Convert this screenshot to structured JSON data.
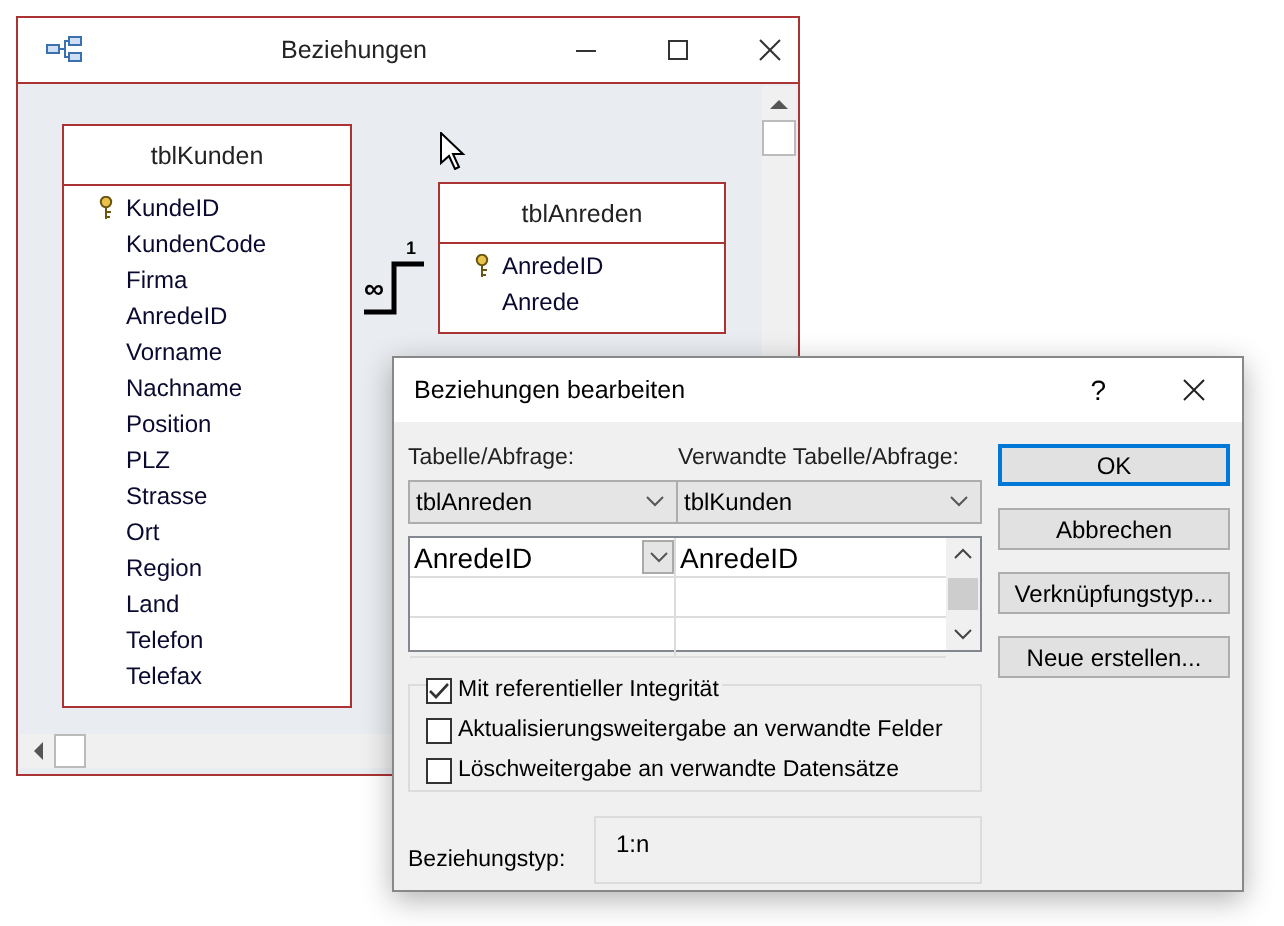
{
  "back_window": {
    "title": "Beziehungen",
    "tables": [
      {
        "name": "tblKunden",
        "fields": [
          {
            "name": "KundeID",
            "primary_key": true
          },
          {
            "name": "KundenCode",
            "primary_key": false
          },
          {
            "name": "Firma",
            "primary_key": false
          },
          {
            "name": "AnredeID",
            "primary_key": false
          },
          {
            "name": "Vorname",
            "primary_key": false
          },
          {
            "name": "Nachname",
            "primary_key": false
          },
          {
            "name": "Position",
            "primary_key": false
          },
          {
            "name": "PLZ",
            "primary_key": false
          },
          {
            "name": "Strasse",
            "primary_key": false
          },
          {
            "name": "Ort",
            "primary_key": false
          },
          {
            "name": "Region",
            "primary_key": false
          },
          {
            "name": "Land",
            "primary_key": false
          },
          {
            "name": "Telefon",
            "primary_key": false
          },
          {
            "name": "Telefax",
            "primary_key": false
          }
        ]
      },
      {
        "name": "tblAnreden",
        "fields": [
          {
            "name": "AnredeID",
            "primary_key": true
          },
          {
            "name": "Anrede",
            "primary_key": false
          }
        ]
      }
    ],
    "relationship": {
      "one_label": "1",
      "many_label": "∞"
    }
  },
  "dialog": {
    "title": "Beziehungen bearbeiten",
    "help": "?",
    "table_label": "Tabelle/Abfrage:",
    "related_label": "Verwandte Tabelle/Abfrage:",
    "table_value": "tblAnreden",
    "related_value": "tblKunden",
    "field_rows": [
      {
        "left": "AnredeID",
        "right": "AnredeID"
      }
    ],
    "options": [
      {
        "label": "Mit referentieller Integrität",
        "checked": true
      },
      {
        "label": "Aktualisierungsweitergabe an verwandte Felder",
        "checked": false
      },
      {
        "label": "Löschweitergabe an verwandte Datensätze",
        "checked": false
      }
    ],
    "relationship_type_label": "Beziehungstyp:",
    "relationship_type": "1:n",
    "buttons": [
      {
        "label": "OK",
        "default": true
      },
      {
        "label": "Abbrechen",
        "default": false
      },
      {
        "label": "Verknüpfungstyp...",
        "default": false
      },
      {
        "label": "Neue erstellen...",
        "default": false
      }
    ]
  }
}
